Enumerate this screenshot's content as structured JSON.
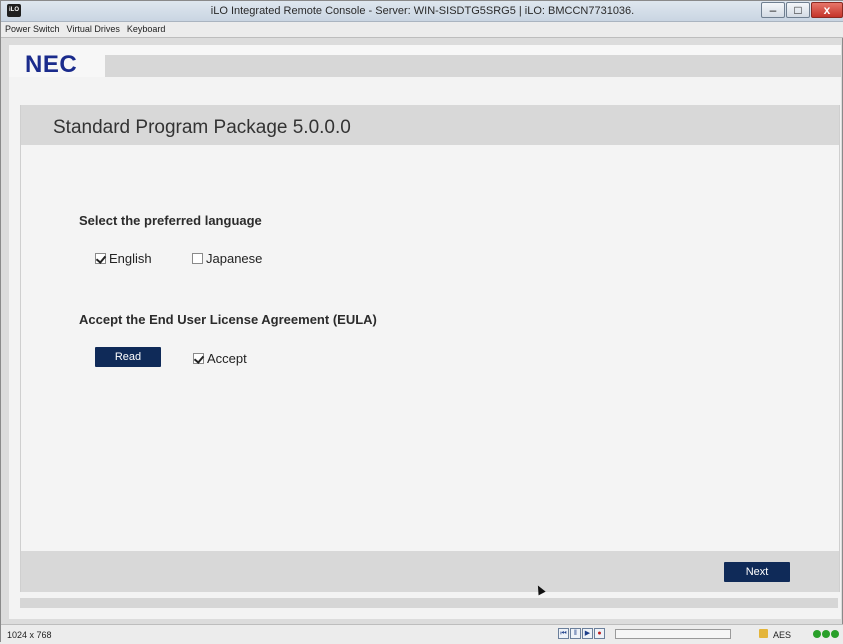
{
  "window": {
    "app_icon": "iLO",
    "title": "iLO Integrated Remote Console - Server: WIN-SISDTG5SRG5 | iLO: BMCCN7731036.",
    "buttons": {
      "minimize": "–",
      "maximize": "□",
      "close": "x"
    }
  },
  "menu": {
    "items": [
      "Power Switch",
      "Virtual Drives",
      "Keyboard"
    ]
  },
  "console": {
    "logo": "NEC",
    "page_title": "Standard Program Package 5.0.0.0",
    "language": {
      "heading": "Select the preferred language",
      "options": [
        {
          "label": "English",
          "checked": true
        },
        {
          "label": "Japanese",
          "checked": false
        }
      ]
    },
    "eula": {
      "heading": "Accept the End User License Agreement (EULA)",
      "read_label": "Read",
      "accept_label": "Accept",
      "accept_checked": true
    },
    "next_label": "Next"
  },
  "status": {
    "resolution": "1024 x 768",
    "media_buttons": [
      "rewind-icon",
      "pause-icon",
      "play-icon",
      "record-icon"
    ],
    "encryption": "AES",
    "indicators": [
      "#2aa02a",
      "#2aa02a",
      "#2aa02a"
    ]
  }
}
